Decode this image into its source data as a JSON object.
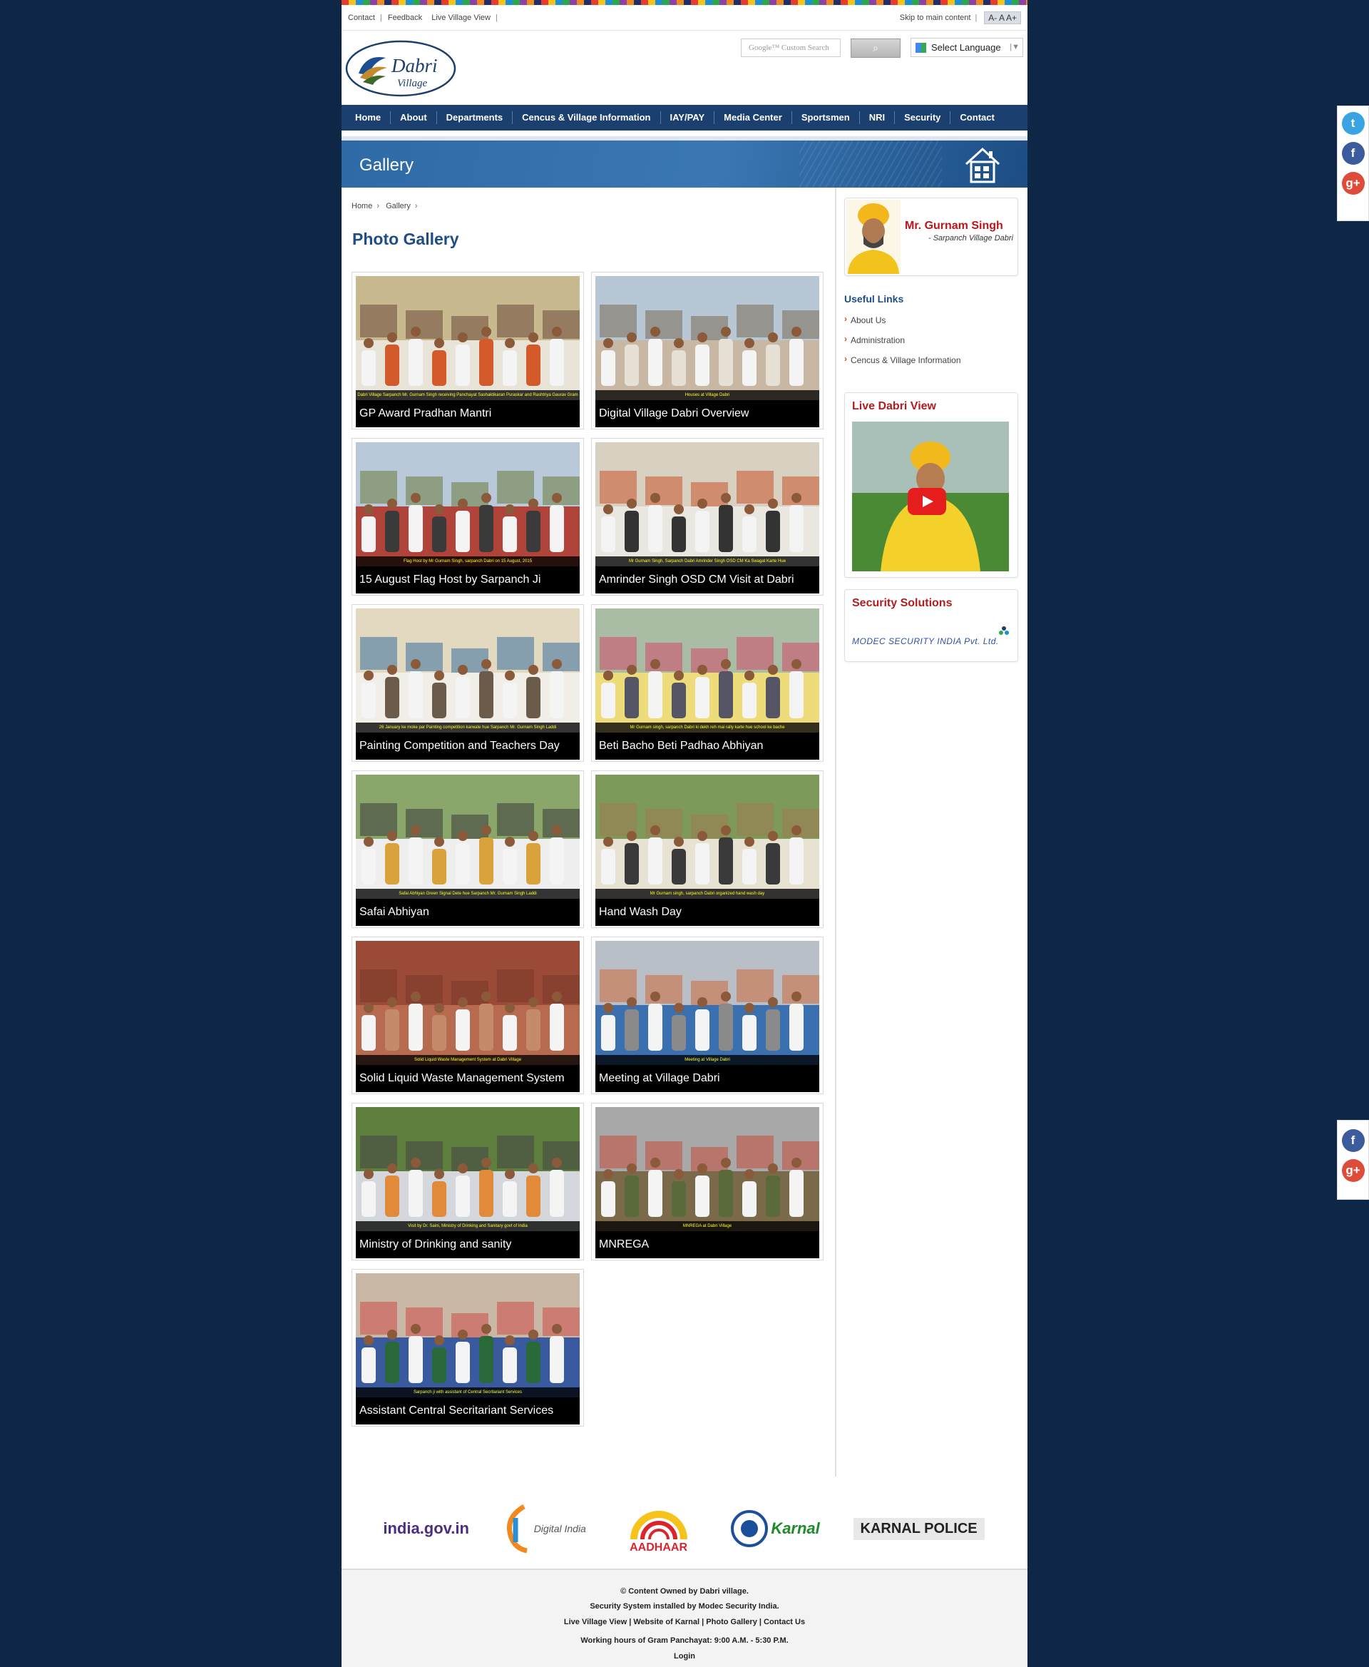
{
  "top": {
    "links": [
      "Contact",
      "Feedback",
      "Live Village View"
    ],
    "skip": "Skip to main content",
    "fontsize": "A- A A+"
  },
  "header": {
    "logo_text": "Dabri",
    "logo_sub": "Village",
    "search_placeholder": "Google™ Custom Search",
    "language": "Select Language"
  },
  "nav": [
    "Home",
    "About",
    "Departments",
    "Cencus & Village Information",
    "IAY/PAY",
    "Media Center",
    "Sportsmen",
    "NRI",
    "Security",
    "Contact"
  ],
  "banner": {
    "title": "Gallery"
  },
  "breadcrumb": [
    "Home",
    "Gallery"
  ],
  "page_title": "Photo Gallery",
  "gallery": [
    {
      "label": "GP Award Pradhan Mantri",
      "caption": "Dabri Village Sarpanch Mr. Gurnam Singh receiving Panchayat Sashaktikaran Puraskar and Rashtriya Gaurav Gram Sabha Puraskar at Vigyan Bhawan, Delhi"
    },
    {
      "label": "Digital Village Dabri Overview",
      "caption": "Houses at Village Dabri"
    },
    {
      "label": "15 August Flag Host by Sarpanch Ji",
      "caption": "Flag Host by Mr Gurnam Singh, sarpanch Dabri on 15 August, 2015"
    },
    {
      "label": "Amrinder Singh OSD CM Visit at Dabri",
      "caption": "Mr Gurnam Singh, Sarpanch Dabri Amrinder Singh OSD CM Ka Swagat Karte Hue"
    },
    {
      "label": "Painting Competition and Teachers Day",
      "caption": "26 January ke moke par Painting competition karwate hue Sarpanch Mr. Gurnam Singh Laddi"
    },
    {
      "label": "Beti Bacho Beti Padhao Abhiyan",
      "caption": "Mr Gurnam singh, sarpanch Dabri ki dekh reh mai rally karte hue school ke bache"
    },
    {
      "label": "Safai Abhiyan",
      "caption": "Safai Abhiyan Green Signal Dete hue Sarpanch Mr. Gurnam Singh Laddi"
    },
    {
      "label": "Hand Wash Day",
      "caption": "Mr Gurnam singh, sarpanch Dabri organized hand wash day"
    },
    {
      "label": "Solid Liquid Waste Management System",
      "caption": "Solid Liquid Waste Management System at Dabri Village"
    },
    {
      "label": "Meeting at Village Dabri",
      "caption": "Meeting at Village Dabri"
    },
    {
      "label": "Ministry of Drinking and sanity",
      "caption": "Visit by Dr. Saini, Ministry of Drinking and Sanitary govt of India"
    },
    {
      "label": "MNREGA",
      "caption": "MNREGA at Dabri Village"
    },
    {
      "label": "Assistant Central Secritariant Services",
      "caption": "Sarpanch ji with assistant of Central Secritariant Services"
    }
  ],
  "sidebar": {
    "sarpanch_name": "Mr. Gurnam Singh",
    "sarpanch_role": "- Sarpanch Village Dabri",
    "useful_title": "Useful Links",
    "useful_links": [
      "About Us",
      "Administration",
      "Cencus & Village Information"
    ],
    "live_title": "Live Dabri View",
    "security_title": "Security Solutions",
    "modec_text": "MODEC SECURITY INDIA Pvt. Ltd."
  },
  "partners": [
    "india.gov.in",
    "Digital India",
    "AADHAAR",
    "Karnal",
    "KARNAL POLICE"
  ],
  "footer": {
    "owned": "© Content Owned by Dabri village.",
    "security": "Security System installed by Modec Security India.",
    "links": [
      "Live Village View",
      "Website of Karnal",
      "Photo Gallery",
      "Contact Us"
    ],
    "hours": "Working hours of Gram Panchayat: 9:00 A.M. - 5:30 P.M.",
    "login": "Login"
  },
  "colors": {
    "brand_blue": "#1b3f6e",
    "title_blue": "#1d4e89",
    "accent_red": "#c0141b",
    "background": "#0f2746"
  }
}
